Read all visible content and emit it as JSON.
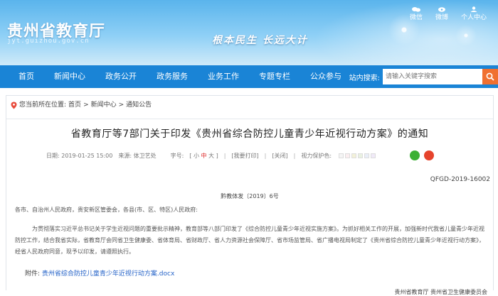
{
  "header": {
    "site_title": "贵州省教育厅",
    "site_url": "jyt.guizhou.gov.cn",
    "slogan": "根本民生  长远大计",
    "top_links": [
      {
        "label": "微信",
        "icon": "wechat-icon"
      },
      {
        "label": "微博",
        "icon": "weibo-icon"
      },
      {
        "label": "个人中心",
        "icon": "user-icon"
      }
    ]
  },
  "nav": {
    "items": [
      "首页",
      "新闻中心",
      "政务公开",
      "政务服务",
      "业务工作",
      "专题专栏",
      "公众参与"
    ],
    "search_label": "站内搜索:",
    "search_placeholder": "请输入关键字搜索"
  },
  "breadcrumb": {
    "prefix": "您当前所在位置:",
    "items": [
      "首页",
      "新闻中心",
      "通知公告"
    ],
    "sep": ">"
  },
  "article": {
    "title": "省教育厅等7部门关于印发《贵州省综合防控儿童青少年近视行动方案》的通知",
    "date": "日期: 2019-01-25 15:00",
    "source": "来源: 体卫艺处",
    "font_label": "字号:",
    "font_small": "小",
    "font_mid": "中",
    "font_large": "大",
    "print": "[我要打印]",
    "close": "[关闭]",
    "vision_label": "视力保护色:",
    "vision_colors": [
      "#f5f5f5",
      "#fbeef0",
      "#f3f1d9",
      "#e9f1e1",
      "#e9eef8",
      "#f0eaf8"
    ],
    "doc_id": "QFGD-2019-16002",
    "doc_no": "黔教体发〔2019〕6号",
    "addressee": "各市、自治州人民政府，贵安新区管委会，各县(市、区、特区)人民政府:",
    "body": "为贯彻落实习近平总书记关于学生近视问题的重要批示精神，教育部等八部门印发了《综合防控儿童青少年近视实施方案》。为抓好相关工作的开展，加强新时代我省儿童青少年近视防控工作，结合我省实际，省教育厅会同省卫生健康委、省体育局、省财政厅、省人力资源社会保障厅、省市场监管局、省广播电视局制定了《贵州省综合防控儿童青少年近视行动方案》，经省人民政府同意，现予以印发，请遵照执行。",
    "attachment_label": "附件:",
    "attachment_name": "贵州省综合防控儿童青少年近视行动方案.docx",
    "signature": "贵州省教育厅  贵州省卫生健康委员会"
  }
}
